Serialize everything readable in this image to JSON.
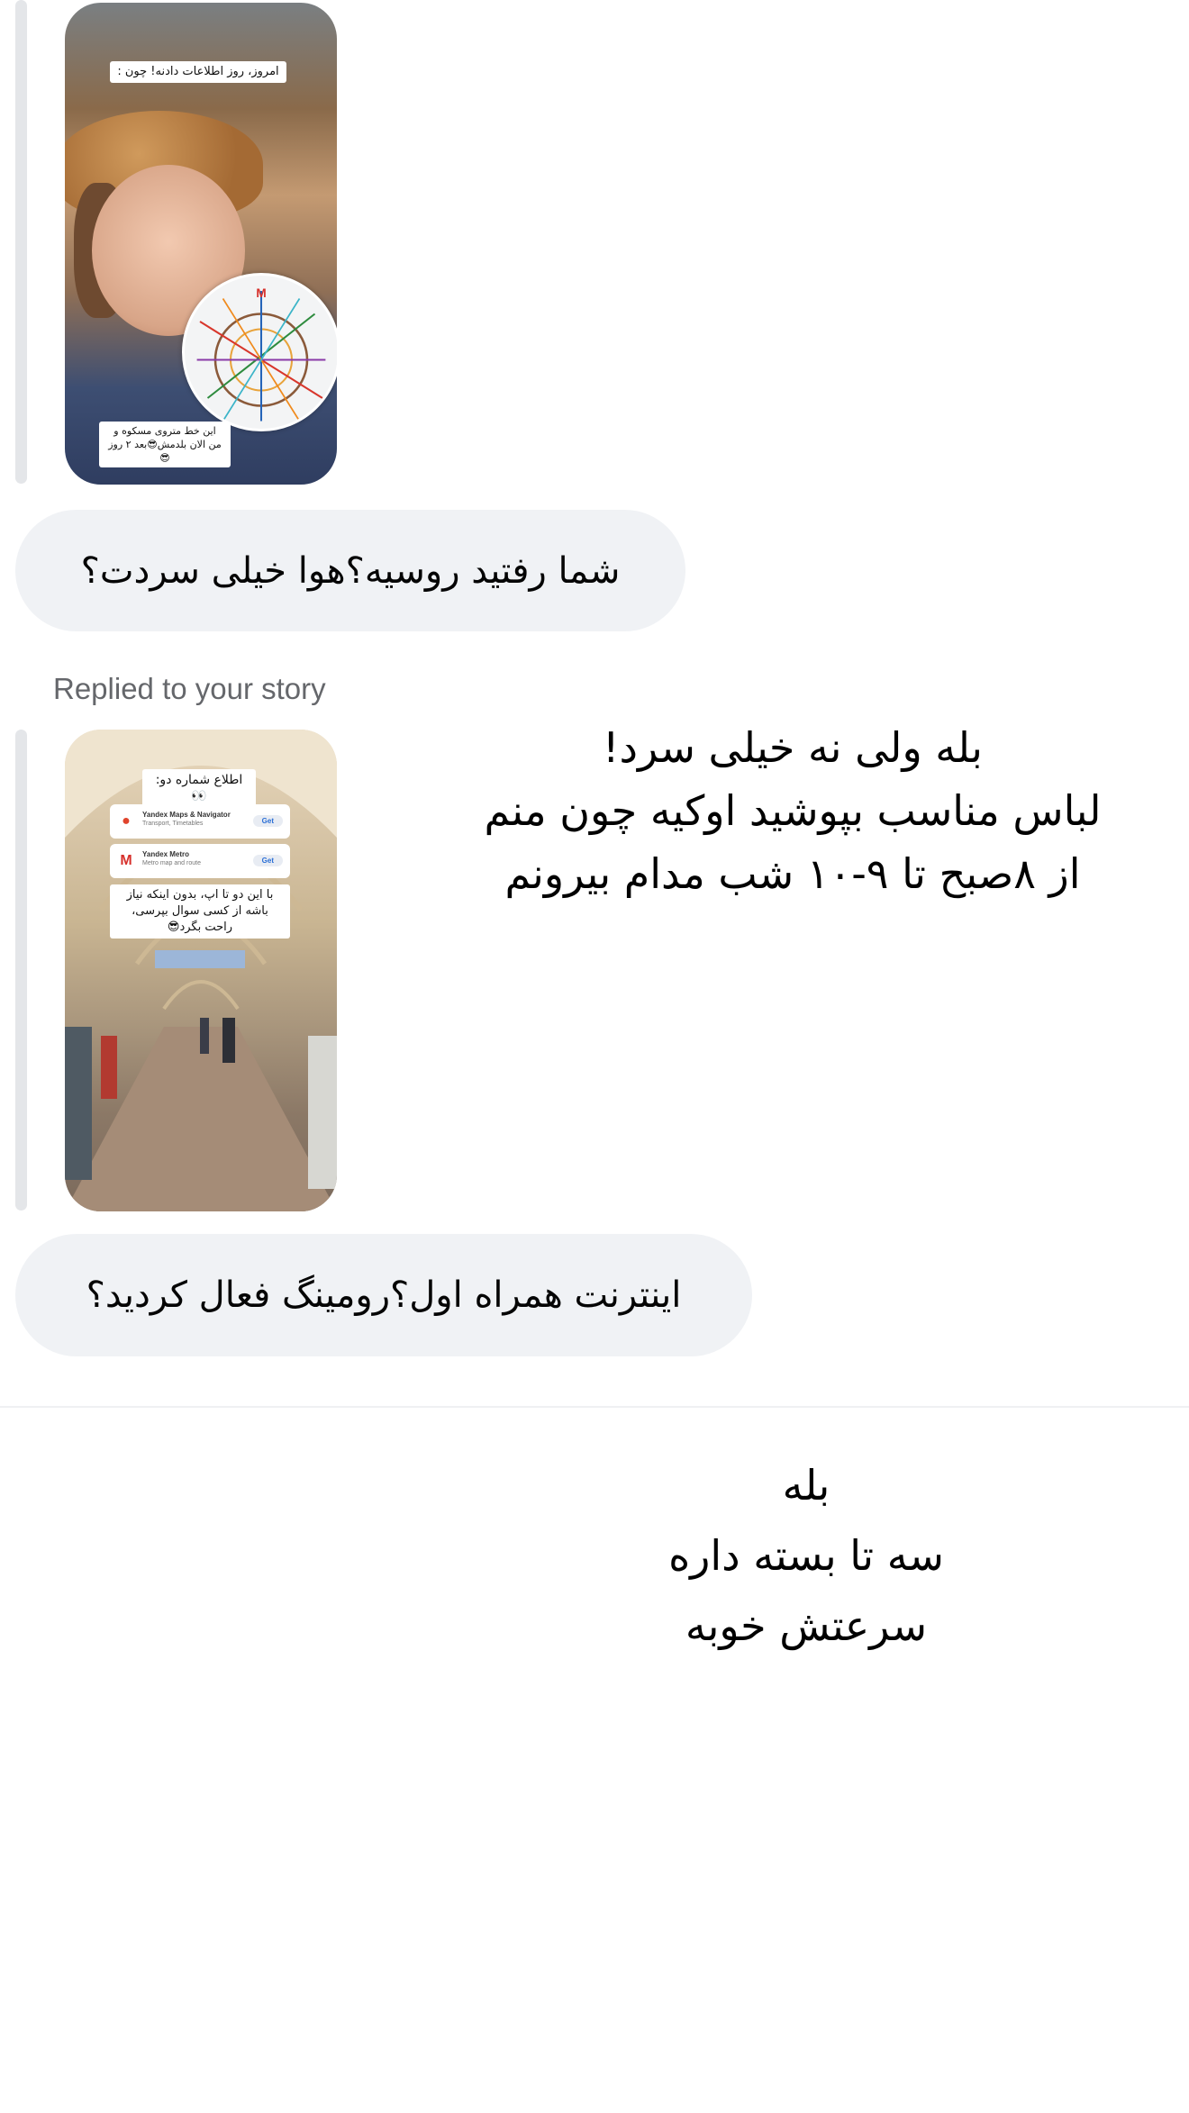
{
  "story1": {
    "caption_top": "امروز، روز اطلاعات دادنه! چون :",
    "caption_bottom": "این خط متروی مسکو‌ه و من الان بلدمش😎بعد ۲ روز😎"
  },
  "message1": {
    "text": "شما رفتید روسیه؟هوا خیلی سردت؟"
  },
  "reply_label": "Replied to your story",
  "story2": {
    "caption_top": "اطلاع شماره دو:👀",
    "apps": [
      {
        "icon": "map-pin-icon",
        "icon_color": "#e0442c",
        "name": "Yandex Maps & Navigator",
        "sub": "Transport, Timetables"
      },
      {
        "icon": "metro-m-icon",
        "icon_color": "#d6302b",
        "name": "Yandex Metro",
        "sub": "Metro map and route"
      }
    ],
    "get_label": "Get",
    "caption_bottom": "با این دو تا اپ، بدون اینکه نیاز باشه از کسی سوال بپرسی، راحت بگرد😎"
  },
  "overlay1": {
    "lines": [
      "بله ولی نه خیلی سرد!",
      "لباس مناسب بپوشید اوکیه چون منم",
      "از ۸صبح تا ۹-۱۰ شب مدام بیرونم"
    ]
  },
  "message2": {
    "text": "اینترنت همراه اول؟رومینگ فعال کردید؟"
  },
  "overlay2": {
    "lines": [
      "بله",
      "سه تا بسته داره",
      "سرعتش خوبه"
    ]
  },
  "colors": {
    "bubble_bg": "#f0f2f5",
    "quote_bar": "#e4e6e9",
    "secondary_text": "#65676b"
  }
}
